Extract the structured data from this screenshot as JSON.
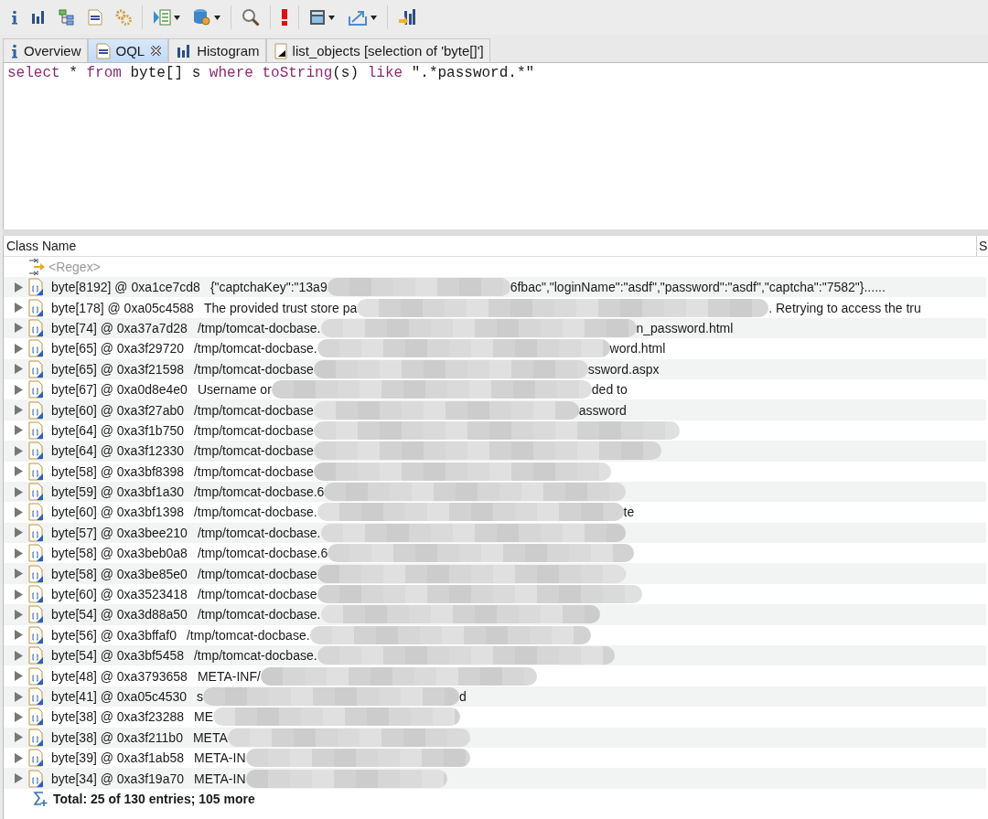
{
  "toolbar": {
    "buttons": [
      {
        "kind": "info"
      },
      {
        "kind": "histogram"
      },
      {
        "kind": "tree"
      },
      {
        "kind": "oql"
      },
      {
        "kind": "gears"
      },
      {
        "kind": "sep"
      },
      {
        "kind": "layout",
        "dropdown": true
      },
      {
        "kind": "database",
        "dropdown": true
      },
      {
        "kind": "sep"
      },
      {
        "kind": "search"
      },
      {
        "kind": "sep"
      },
      {
        "kind": "alert"
      },
      {
        "kind": "sep"
      },
      {
        "kind": "calculator",
        "dropdown": true
      },
      {
        "kind": "export",
        "dropdown": true
      },
      {
        "kind": "sep"
      },
      {
        "kind": "compare"
      }
    ]
  },
  "tabs": [
    {
      "label": "Overview",
      "kind": "overview",
      "selected": false,
      "closable": false
    },
    {
      "label": "OQL",
      "kind": "query",
      "selected": true,
      "closable": true
    },
    {
      "label": "Histogram",
      "kind": "histogram",
      "selected": false,
      "closable": false
    },
    {
      "label": "list_objects  [selection of 'byte[]']",
      "kind": "list",
      "selected": false,
      "closable": false
    }
  ],
  "query": [
    {
      "text": "select",
      "kind": "keyword"
    },
    {
      "text": " * ",
      "kind": "plain"
    },
    {
      "text": "from",
      "kind": "keyword"
    },
    {
      "text": " byte[] s ",
      "kind": "plain"
    },
    {
      "text": "where toString",
      "kind": "keyword"
    },
    {
      "text": "(s) ",
      "kind": "plain"
    },
    {
      "text": "like",
      "kind": "keyword"
    },
    {
      "text": " \".*password.*\"",
      "kind": "plain"
    }
  ],
  "table": {
    "columns": [
      "Class Name",
      "S"
    ],
    "filter": {
      "placeholder": "<Regex>"
    },
    "rows": [
      {
        "object": "byte[8192] @ 0xa1ce7cd8",
        "text_before": "{\"captchaKey\":\"13a9",
        "text_after": "6fbac\",\"loginName\":\"asdf\",\"password\":\"asdf\",\"captcha\":\"7582\"}......"
      },
      {
        "object": "byte[178] @ 0xa05c4588",
        "text_before": "The provided trust store pa",
        "text_after": ". Retrying to access the tru"
      },
      {
        "object": "byte[74] @ 0xa37a7d28",
        "text_before": "/tmp/tomcat-docbase.",
        "text_after": "n_password.html"
      },
      {
        "object": "byte[65] @ 0xa3f29720",
        "text_before": "/tmp/tomcat-docbase.",
        "text_after": "word.html"
      },
      {
        "object": "byte[65] @ 0xa3f21598",
        "text_before": "/tmp/tomcat-docbase",
        "text_after": "ssword.aspx"
      },
      {
        "object": "byte[67] @ 0xa0d8e4e0",
        "text_before": "Username or",
        "text_after": "ded to"
      },
      {
        "object": "byte[60] @ 0xa3f27ab0",
        "text_before": "/tmp/tomcat-docbase",
        "text_after": "assword"
      },
      {
        "object": "byte[64] @ 0xa3f1b750",
        "text_before": "/tmp/tomcat-docbase"
      },
      {
        "object": "byte[64] @ 0xa3f12330",
        "text_before": "/tmp/tomcat-docbase"
      },
      {
        "object": "byte[58] @ 0xa3bf8398",
        "text_before": "/tmp/tomcat-docbase"
      },
      {
        "object": "byte[59] @ 0xa3bf1a30",
        "text_before": "/tmp/tomcat-docbase.6"
      },
      {
        "object": "byte[60] @ 0xa3bf1398",
        "text_before": "/tmp/tomcat-docbase.",
        "text_after": "te"
      },
      {
        "object": "byte[57] @ 0xa3bee210",
        "text_before": "/tmp/tomcat-docbase."
      },
      {
        "object": "byte[58] @ 0xa3beb0a8",
        "text_before": "/tmp/tomcat-docbase.6"
      },
      {
        "object": "byte[58] @ 0xa3be85e0",
        "text_before": "/tmp/tomcat-docbase"
      },
      {
        "object": "byte[60] @ 0xa3523418",
        "text_before": "/tmp/tomcat-docbase"
      },
      {
        "object": "byte[54] @ 0xa3d88a50",
        "text_before": "/tmp/tomcat-docbase."
      },
      {
        "object": "byte[56] @ 0xa3bffaf0",
        "text_before": "/tmp/tomcat-docbase."
      },
      {
        "object": "byte[54] @ 0xa3bf5458",
        "text_before": "/tmp/tomcat-docbase."
      },
      {
        "object": "byte[48] @ 0xa3793658",
        "text_before": "META-INF/"
      },
      {
        "object": "byte[41] @ 0xa05c4530",
        "text_before": "s",
        "text_after": "d"
      },
      {
        "object": "byte[38] @ 0xa3f23288",
        "text_before": "ME"
      },
      {
        "object": "byte[38] @ 0xa3f211b0",
        "text_before": "META"
      },
      {
        "object": "byte[39] @ 0xa3f1ab58",
        "text_before": "META-IN"
      },
      {
        "object": "byte[34] @ 0xa3f19a70",
        "text_before": "META-IN"
      }
    ],
    "total": "Total: 25 of 130 entries; 105 more"
  }
}
